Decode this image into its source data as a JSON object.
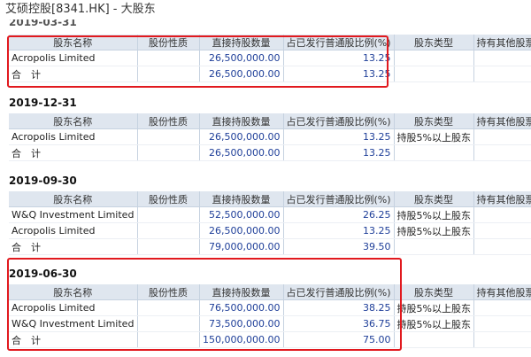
{
  "page_title": "艾硕控股[8341.HK] - 大股东",
  "columns": [
    "股东名称",
    "股份性质",
    "直接持股数量",
    "占已发行普通股比例(%)",
    "股东类型",
    "持有其他股票"
  ],
  "sections": [
    {
      "date": "2019-03-31",
      "rows": [
        {
          "name": "Acropolis Limited",
          "nature": "",
          "shares": "26,500,000.00",
          "pct": "13.25",
          "type": "",
          "other": ""
        },
        {
          "name": "合　计",
          "nature": "",
          "shares": "26,500,000.00",
          "pct": "13.25",
          "type": "",
          "other": ""
        }
      ]
    },
    {
      "date": "2019-12-31",
      "rows": [
        {
          "name": "Acropolis Limited",
          "nature": "",
          "shares": "26,500,000.00",
          "pct": "13.25",
          "type": "持股5%以上股东",
          "other": ""
        },
        {
          "name": "合　计",
          "nature": "",
          "shares": "26,500,000.00",
          "pct": "13.25",
          "type": "",
          "other": ""
        }
      ]
    },
    {
      "date": "2019-09-30",
      "rows": [
        {
          "name": "W&Q Investment Limited",
          "nature": "",
          "shares": "52,500,000.00",
          "pct": "26.25",
          "type": "持股5%以上股东",
          "other": ""
        },
        {
          "name": "Acropolis Limited",
          "nature": "",
          "shares": "26,500,000.00",
          "pct": "13.25",
          "type": "持股5%以上股东",
          "other": ""
        },
        {
          "name": "合　计",
          "nature": "",
          "shares": "79,000,000.00",
          "pct": "39.50",
          "type": "",
          "other": ""
        }
      ]
    },
    {
      "date": "2019-06-30",
      "rows": [
        {
          "name": "Acropolis Limited",
          "nature": "",
          "shares": "76,500,000.00",
          "pct": "38.25",
          "type": "持股5%以上股东",
          "other": ""
        },
        {
          "name": "W&Q Investment Limited",
          "nature": "",
          "shares": "73,500,000.00",
          "pct": "36.75",
          "type": "持股5%以上股东",
          "other": ""
        },
        {
          "name": "合　计",
          "nature": "",
          "shares": "150,000,000.00",
          "pct": "75.00",
          "type": "",
          "other": ""
        }
      ]
    }
  ]
}
